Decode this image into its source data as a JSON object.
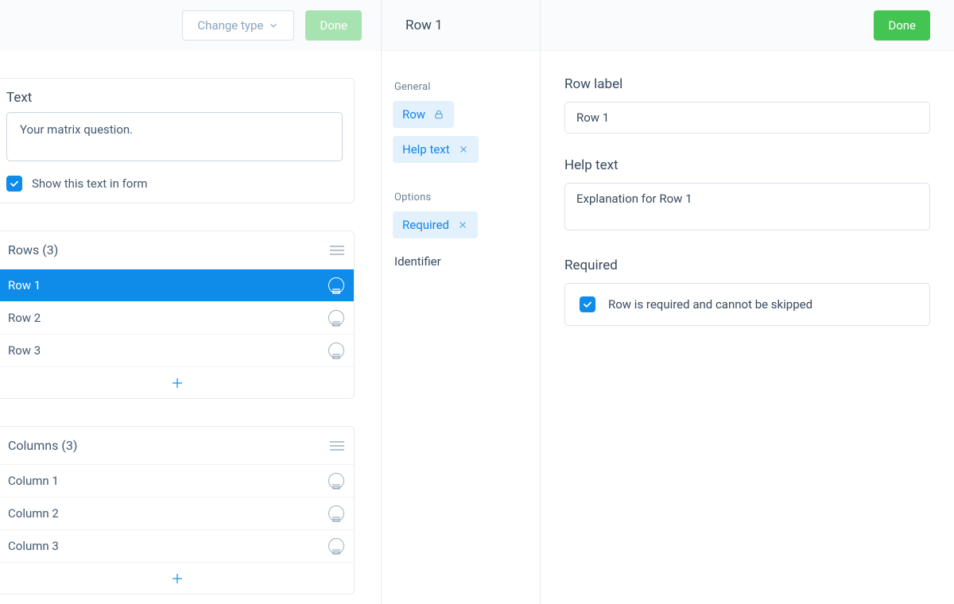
{
  "left": {
    "changeTypeLabel": "Change type",
    "doneLabel": "Done",
    "textSection": {
      "title": "Text",
      "question": "Your matrix question.",
      "showInFormLabel": "Show this text in form"
    },
    "rowsHeader": "Rows (3)",
    "rows": [
      {
        "label": "Row 1",
        "selected": true
      },
      {
        "label": "Row 2",
        "selected": false
      },
      {
        "label": "Row 3",
        "selected": false
      }
    ],
    "columnsHeader": "Columns (3)",
    "columns": [
      {
        "label": "Column 1"
      },
      {
        "label": "Column 2"
      },
      {
        "label": "Column 3"
      }
    ]
  },
  "mid": {
    "title": "Row 1",
    "generalLabel": "General",
    "optionsLabel": "Options",
    "pills": {
      "row": "Row",
      "helpText": "Help text",
      "required": "Required"
    },
    "identifierLabel": "Identifier"
  },
  "right": {
    "doneLabel": "Done",
    "rowLabel": {
      "label": "Row label",
      "value": "Row 1"
    },
    "helpText": {
      "label": "Help text",
      "value": "Explanation for Row 1"
    },
    "required": {
      "label": "Required",
      "message": "Row is required and cannot be skipped"
    }
  },
  "icons": {
    "chevronDown": "chevron-down-icon",
    "hamburger": "menu-icon",
    "plus": "plus-icon",
    "lock": "lock-icon",
    "close": "close-icon",
    "check": "check-icon"
  }
}
